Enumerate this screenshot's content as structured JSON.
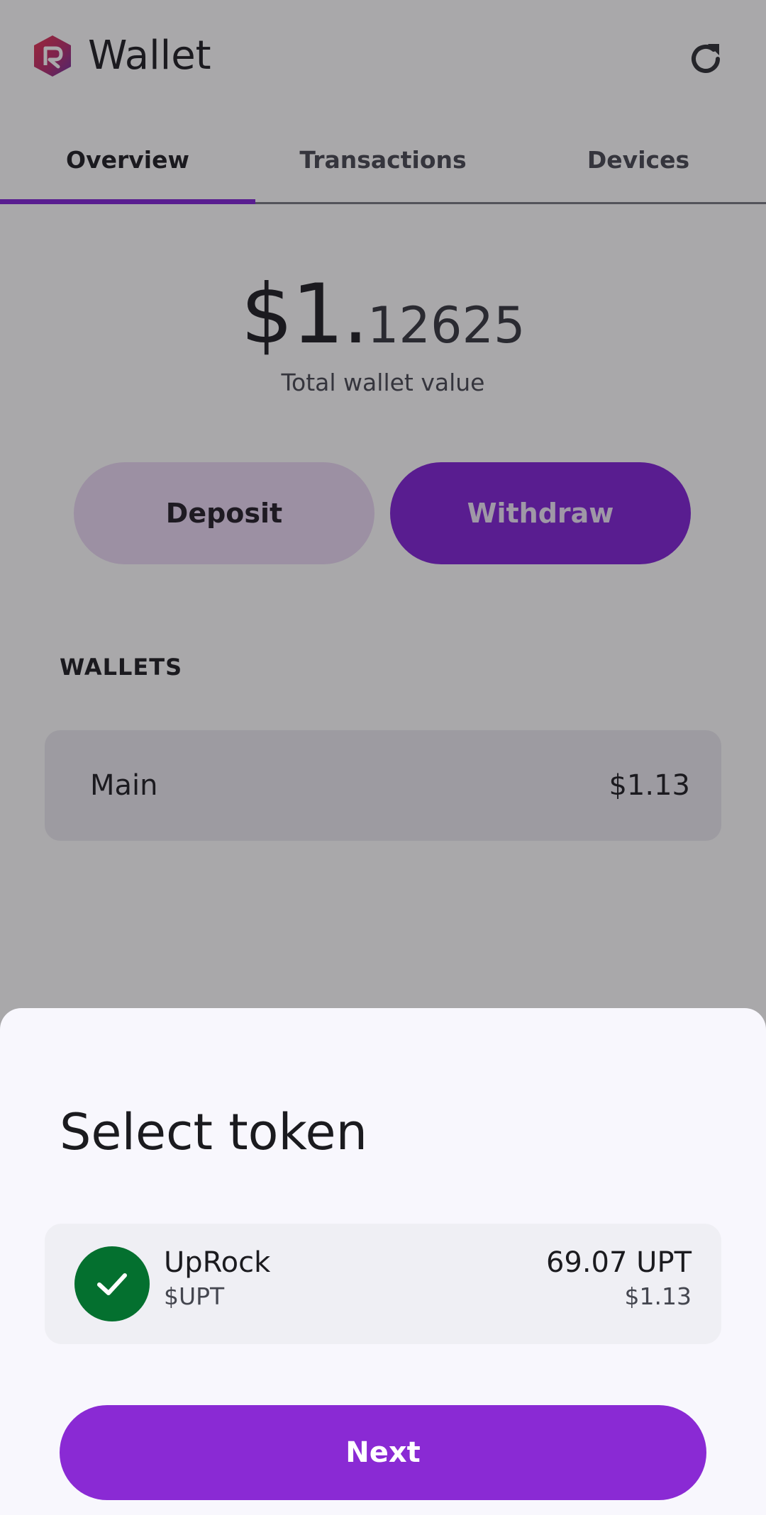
{
  "header": {
    "title": "Wallet",
    "logo_icon": "uprock-logo-icon",
    "refresh_icon": "refresh-icon"
  },
  "tabs": [
    {
      "label": "Overview",
      "active": true
    },
    {
      "label": "Transactions",
      "active": false
    },
    {
      "label": "Devices",
      "active": false
    }
  ],
  "balance": {
    "integer_part": "$1.",
    "decimal_part": "12625",
    "label": "Total wallet value"
  },
  "actions": {
    "deposit_label": "Deposit",
    "withdraw_label": "Withdraw"
  },
  "wallets": {
    "heading": "WALLETS",
    "items": [
      {
        "name": "Main",
        "value": "$1.13"
      }
    ]
  },
  "sheet": {
    "title": "Select token",
    "tokens": [
      {
        "name": "UpRock",
        "symbol": "$UPT",
        "amount": "69.07 UPT",
        "usd_value": "$1.13",
        "selected": true,
        "icon": "check-icon"
      }
    ],
    "next_label": "Next"
  },
  "colors": {
    "accent": "#7e20d6",
    "next_button": "#8a2ad4",
    "selected_check": "#04702f",
    "sheet_background": "#f8f7fd"
  }
}
